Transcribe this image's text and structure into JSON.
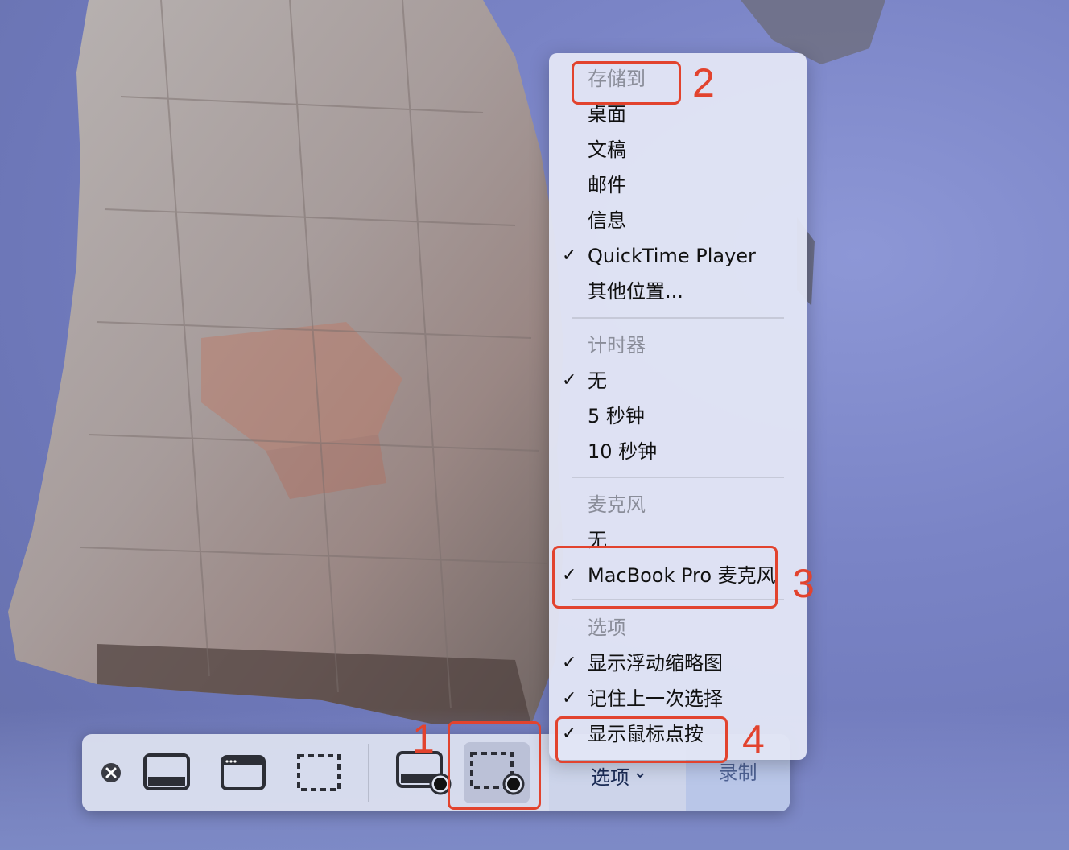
{
  "menu": {
    "save_to": {
      "header": "存储到",
      "items": [
        {
          "label": "桌面",
          "checked": false
        },
        {
          "label": "文稿",
          "checked": false
        },
        {
          "label": "邮件",
          "checked": false
        },
        {
          "label": "信息",
          "checked": false
        },
        {
          "label": "QuickTime Player",
          "checked": true
        },
        {
          "label": "其他位置...",
          "checked": false
        }
      ]
    },
    "timer": {
      "header": "计时器",
      "items": [
        {
          "label": "无",
          "checked": true
        },
        {
          "label": "5 秒钟",
          "checked": false
        },
        {
          "label": "10 秒钟",
          "checked": false
        }
      ]
    },
    "microphone": {
      "header": "麦克风",
      "items": [
        {
          "label": "无",
          "checked": false
        },
        {
          "label": "MacBook Pro 麦克风",
          "checked": true
        }
      ]
    },
    "options": {
      "header": "选项",
      "items": [
        {
          "label": "显示浮动缩略图",
          "checked": true
        },
        {
          "label": "记住上一次选择",
          "checked": true
        },
        {
          "label": "显示鼠标点按",
          "checked": true
        }
      ]
    },
    "check_glyph": "✓"
  },
  "toolbar": {
    "options_label": "选项",
    "options_chevron": "⌄",
    "record_label": "录制",
    "icons": [
      "close-icon",
      "capture-entire-screen-icon",
      "capture-window-icon",
      "capture-selection-icon",
      "record-entire-screen-icon",
      "record-selection-icon"
    ]
  },
  "annotations": {
    "labels": [
      "1",
      "2",
      "3",
      "4"
    ],
    "color": "#e2432e"
  }
}
